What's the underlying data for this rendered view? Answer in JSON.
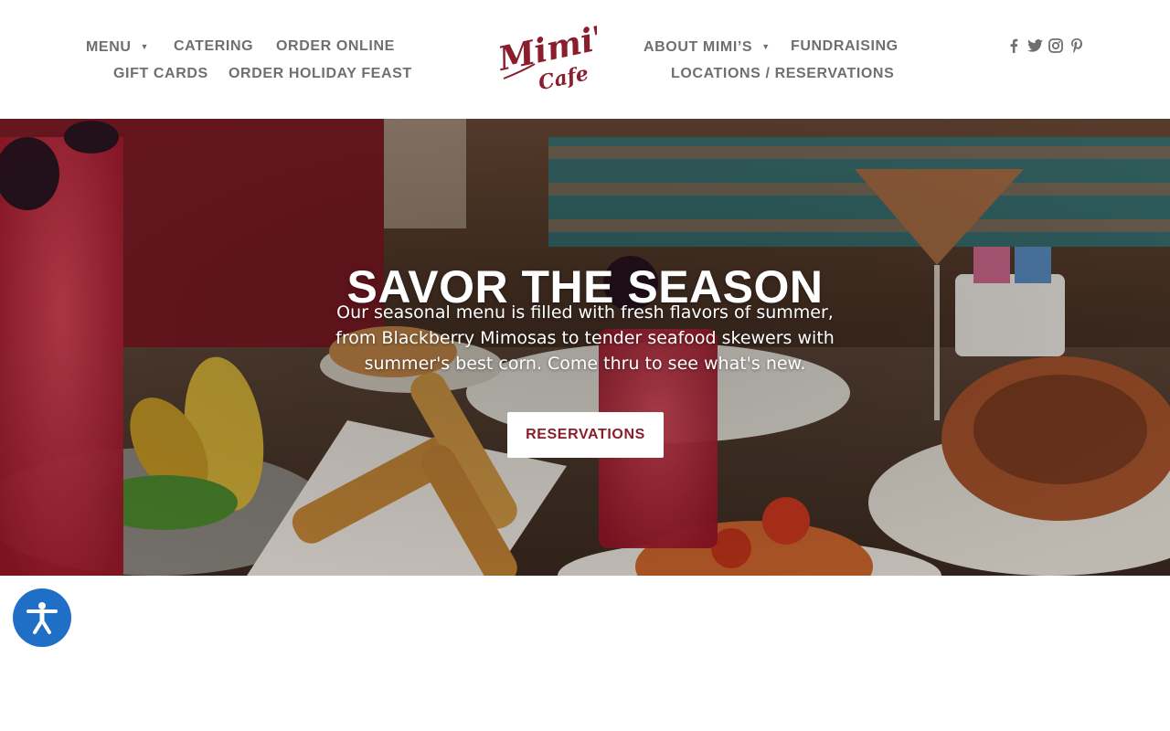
{
  "header": {
    "nav_left_row1": [
      {
        "label": "MENU",
        "has_dropdown": true
      },
      {
        "label": "CATERING",
        "has_dropdown": false
      },
      {
        "label": "ORDER ONLINE",
        "has_dropdown": false
      }
    ],
    "nav_left_row2": [
      {
        "label": "GIFT CARDS",
        "has_dropdown": false
      },
      {
        "label": "ORDER HOLIDAY FEAST",
        "has_dropdown": false
      }
    ],
    "nav_right_row1": [
      {
        "label": "ABOUT MIMI’S",
        "has_dropdown": true
      },
      {
        "label": "FUNDRAISING",
        "has_dropdown": false
      }
    ],
    "nav_right_row2": [
      {
        "label": "LOCATIONS / RESERVATIONS",
        "has_dropdown": false
      }
    ],
    "dropdown_caret": "▼",
    "logo": {
      "line1": "Mimi's",
      "line2": "Cafe",
      "color": "#8a1e2c"
    },
    "social": [
      {
        "icon": "facebook-icon"
      },
      {
        "icon": "twitter-icon"
      },
      {
        "icon": "instagram-icon"
      },
      {
        "icon": "pinterest-icon"
      }
    ],
    "nav_color": "#6f6f6f"
  },
  "hero": {
    "title": "SAVOR THE SEASON",
    "description": "Our seasonal menu is filled with fresh flavors of summer, from Blackberry Mimosas to tender seafood skewers with summer's best corn. Come thru to see what's new.",
    "button_label": "RESERVATIONS",
    "button_text_color": "#8a1e2c"
  },
  "accessibility": {
    "icon": "accessibility-icon",
    "color": "#1f6fc6"
  }
}
